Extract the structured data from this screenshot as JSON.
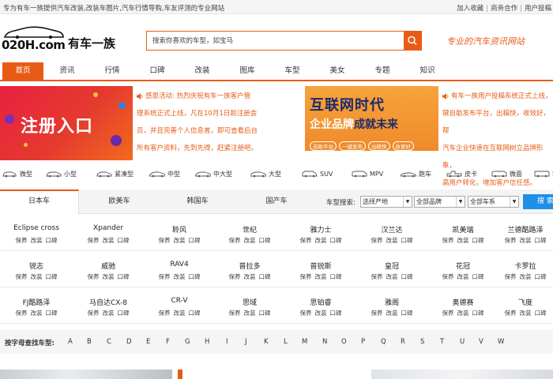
{
  "topbar": {
    "slogan": "专为有车一族提供汽车改装,改装车图片,汽车行情导购,车友评测的专业网站",
    "links": [
      "加入收藏",
      "商务合作",
      "用户投稿"
    ]
  },
  "header": {
    "logo_domain": "020H.com",
    "logo_name": "有车一族",
    "search_placeholder": "搜索你喜欢的车型，如宝马",
    "slogan": "专业的汽车资讯网站"
  },
  "nav": {
    "items": [
      "首页",
      "资讯",
      "行情",
      "口碑",
      "改装",
      "图库",
      "车型",
      "美女",
      "专题",
      "知识"
    ],
    "active_index": 0
  },
  "banners": {
    "register_text": "注册入口",
    "promo_left": [
      "感恩活动: 热烈庆祝有车一族客户管",
      "理系统正式上线，凡在10月1日前注册会",
      "员，并且完善个人信息者，即可查看后台",
      "所有客户资料，先到先得，赶紧注册吧。"
    ],
    "internet_title": "互联网时代",
    "internet_sub_a": "企业品牌",
    "internet_sub_b": "成就未来",
    "internet_tags": [
      "自助平台",
      "一键发布",
      "出精快",
      "收更好"
    ],
    "promo_right": [
      "有车一族用户投稿系统正式上线，",
      "键自助发布平台，出稿快，收效好，帮",
      "汽车企业快速在互联网树立品牌形象，",
      "高用户转化，增加客户信任感。"
    ]
  },
  "car_types": [
    "微型",
    "小型",
    "紧凑型",
    "中型",
    "中大型",
    "大型",
    "SUV",
    "MPV",
    "跑车",
    "皮卡",
    "微面",
    "客车"
  ],
  "brand_tabs": {
    "items": [
      "日本车",
      "欧美车",
      "韩国车",
      "国产车"
    ],
    "active_index": 0,
    "filter_label": "车型搜索:",
    "selects": [
      "选择产地",
      "全部品牌",
      "全部车系"
    ],
    "search_button": "搜 索"
  },
  "models": {
    "rows": [
      [
        "Eclipse cross",
        "Xpander",
        "聆风",
        "世纪",
        "雅力士",
        "汉兰达",
        "凯美瑞",
        "兰德酷路泽"
      ],
      [
        "锐志",
        "威驰",
        "RAV4",
        "普拉多",
        "普锐斯",
        "皇冠",
        "花冠",
        "卡罗拉"
      ],
      [
        "FJ酷路泽",
        "马自达CX-8",
        "CR-V",
        "思域",
        "思铂睿",
        "雅阁",
        "奥德赛",
        "飞度"
      ]
    ],
    "sub_links": [
      "保养",
      "改装",
      "口碑"
    ]
  },
  "letters": {
    "label": "按字母查找车型:",
    "items": [
      "A",
      "B",
      "C",
      "D",
      "E",
      "F",
      "G",
      "H",
      "I",
      "J",
      "K",
      "L",
      "M",
      "N",
      "O",
      "P",
      "Q",
      "R",
      "S",
      "T",
      "U",
      "V",
      "W"
    ]
  },
  "colors": {
    "accent": "#e85b16",
    "search_blue": "#1e90e8"
  }
}
